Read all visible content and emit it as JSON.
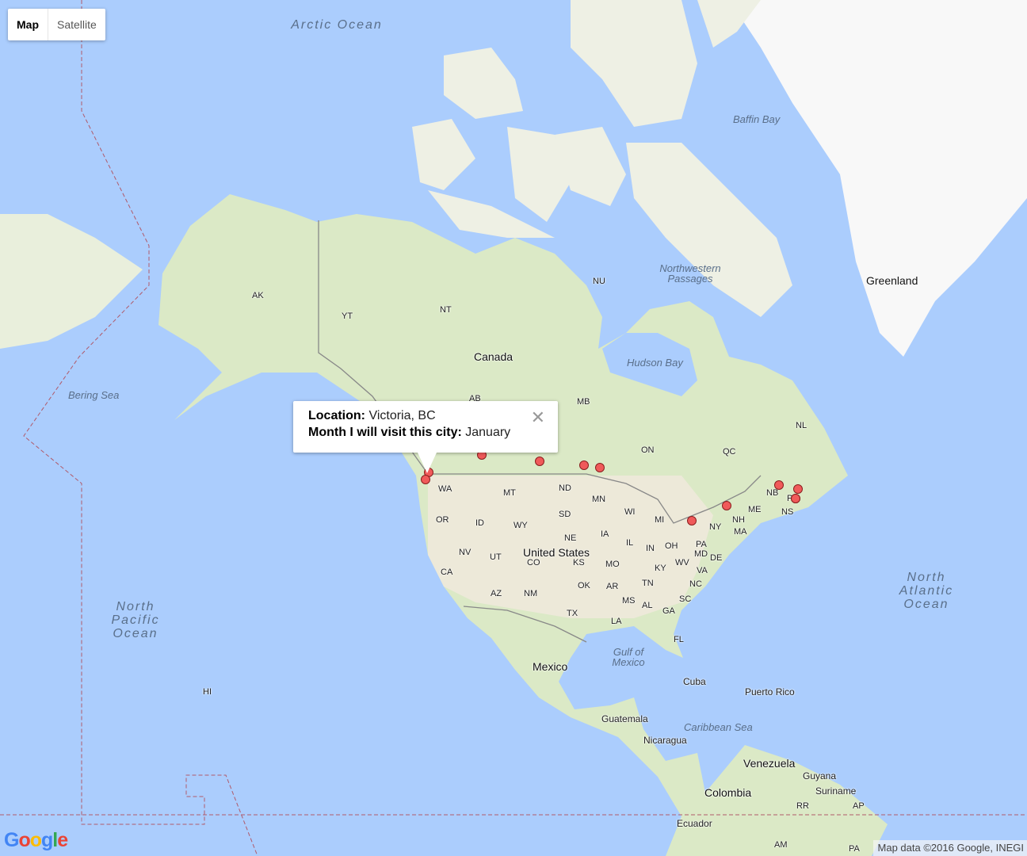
{
  "map_type": {
    "options": [
      "Map",
      "Satellite"
    ],
    "selected": "Map"
  },
  "colors": {
    "ocean": "#abcdfd",
    "land": "#e8efd9",
    "greenland": "#f8f8f8",
    "marker": "#f05a5a"
  },
  "info_window": {
    "location_label": "Location:",
    "location_value": " Victoria, BC",
    "month_label": "Month I will visit this city:",
    "month_value": " January",
    "close_icon": "close-icon"
  },
  "labels": {
    "oceans": [
      "Arctic Ocean",
      "North Pacific Ocean",
      "North Atlantic Ocean"
    ],
    "water": [
      "Baffin Bay",
      "Northwestern Passages",
      "Hudson Bay",
      "Bering Sea",
      "Gulf of Mexico",
      "Caribbean Sea"
    ],
    "countries": [
      "Canada",
      "United States",
      "Mexico",
      "Greenland",
      "Cuba",
      "Puerto Rico",
      "Guatemala",
      "Nicaragua",
      "Venezuela",
      "Colombia",
      "Guyana",
      "Suriname",
      "Ecuador"
    ],
    "regions": [
      "AK",
      "YT",
      "NT",
      "NU",
      "AB",
      "MB",
      "ON",
      "QC",
      "NL",
      "NB",
      "NS",
      "PE",
      "WA",
      "MT",
      "ND",
      "MN",
      "OR",
      "ID",
      "WY",
      "SD",
      "WI",
      "MI",
      "NY",
      "NH",
      "ME",
      "MA",
      "NE",
      "IA",
      "IL",
      "IN",
      "OH",
      "PA",
      "MD",
      "DE",
      "NV",
      "UT",
      "CO",
      "KS",
      "MO",
      "KY",
      "WV",
      "VA",
      "CA",
      "AZ",
      "NM",
      "OK",
      "AR",
      "TN",
      "NC",
      "SC",
      "MS",
      "AL",
      "GA",
      "TX",
      "LA",
      "FL",
      "HI",
      "RR",
      "AP",
      "AM",
      "PA"
    ]
  },
  "markers_count": 12,
  "logo": "Google",
  "attribution": "Map data ©2016 Google, INEGI"
}
